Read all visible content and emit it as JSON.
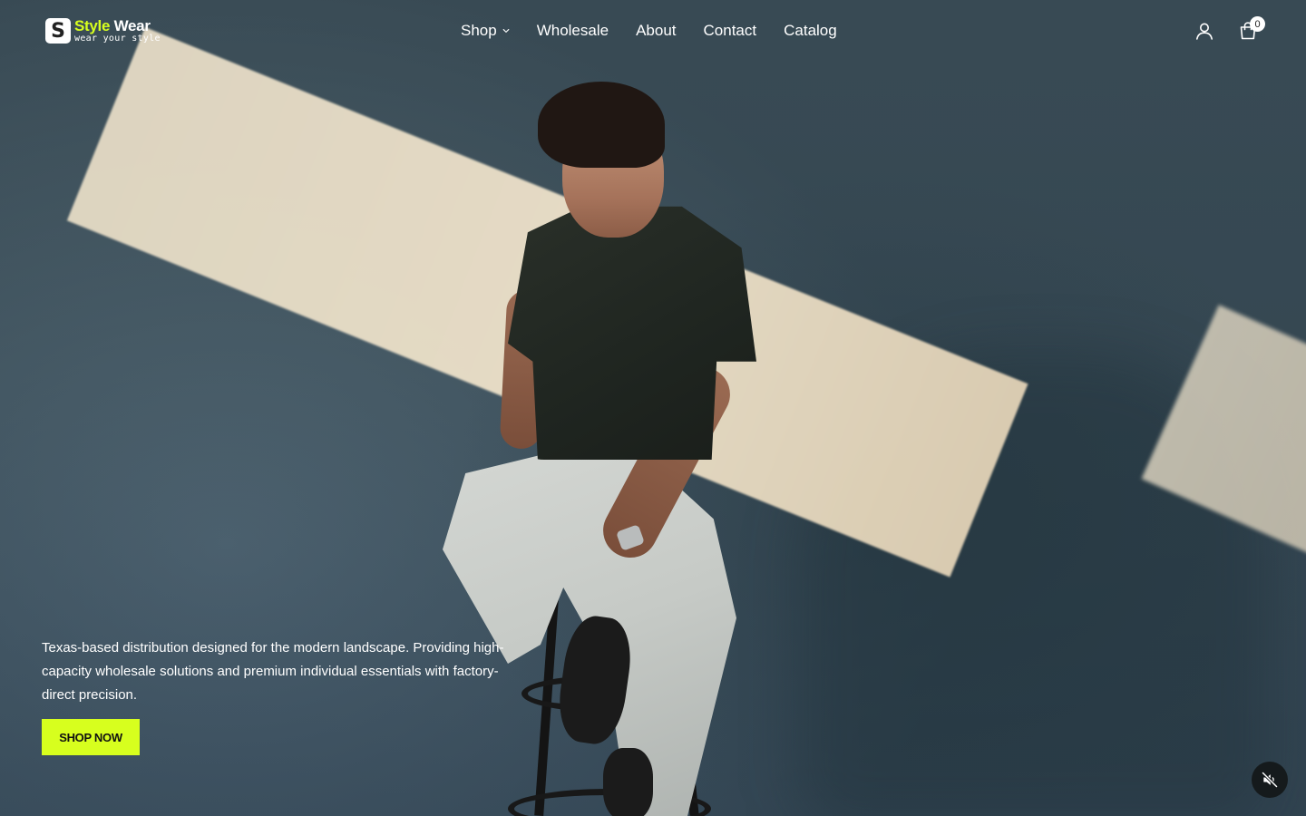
{
  "brand": {
    "name_part1": "Style",
    "name_part2": "Wear",
    "tagline": "wear your style",
    "accent_color": "#d7ff1e"
  },
  "nav": {
    "items": [
      {
        "label": "Shop",
        "has_dropdown": true
      },
      {
        "label": "Wholesale"
      },
      {
        "label": "About"
      },
      {
        "label": "Contact"
      },
      {
        "label": "Catalog"
      }
    ]
  },
  "header_icons": {
    "account_icon": "user-icon",
    "cart_icon": "shopping-bag-icon",
    "cart_count": "0"
  },
  "hero": {
    "text": "Texas-based distribution designed for the modern landscape. Providing high-capacity wholesale solutions and premium individual essentials with factory-direct precision.",
    "cta_label": "SHOP NOW",
    "media_control_icon": "volume-muted-icon"
  }
}
